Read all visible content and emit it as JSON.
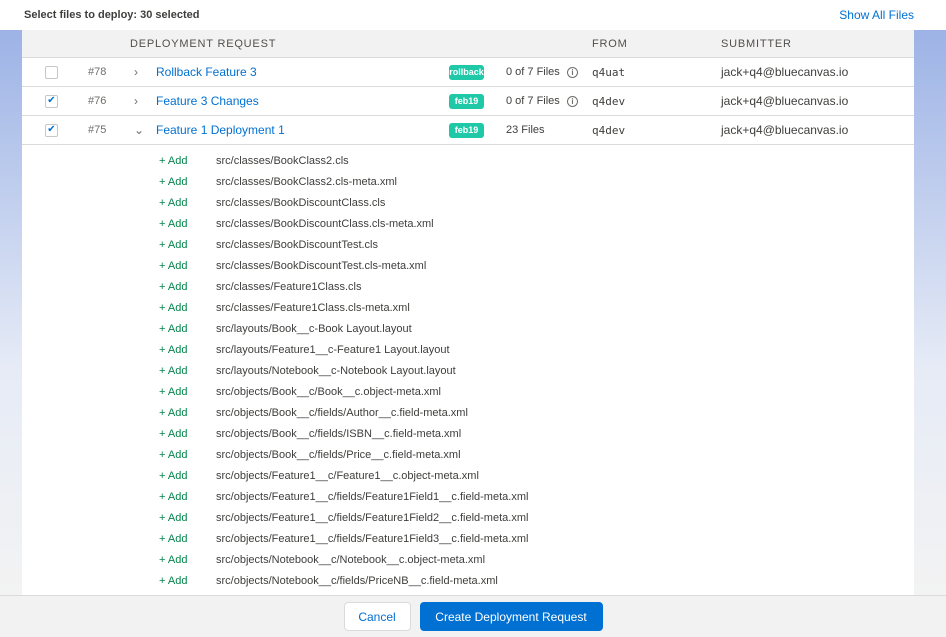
{
  "header": {
    "select_label": "Select files to deploy: 30 selected",
    "show_all": "Show All Files"
  },
  "table": {
    "columns": {
      "request": "DEPLOYMENT REQUEST",
      "from": "FROM",
      "submitter": "SUBMITTER"
    },
    "rows": [
      {
        "checked": false,
        "number": "#78",
        "title": "Rollback Feature 3",
        "badge": "rollback",
        "files": "0 of 7 Files",
        "info": true,
        "from": "q4uat",
        "submitter": "jack+q4@bluecanvas.io",
        "expanded": false
      },
      {
        "checked": true,
        "number": "#76",
        "title": "Feature 3 Changes",
        "badge": "feb19",
        "files": "0 of 7 Files",
        "info": true,
        "from": "q4dev",
        "submitter": "jack+q4@bluecanvas.io",
        "expanded": false
      },
      {
        "checked": true,
        "number": "#75",
        "title": "Feature 1 Deployment 1",
        "badge": "feb19",
        "files": "23 Files",
        "info": false,
        "from": "q4dev",
        "submitter": "jack+q4@bluecanvas.io",
        "expanded": true
      }
    ]
  },
  "file_action_label": "+ Add",
  "files": [
    "src/classes/BookClass2.cls",
    "src/classes/BookClass2.cls-meta.xml",
    "src/classes/BookDiscountClass.cls",
    "src/classes/BookDiscountClass.cls-meta.xml",
    "src/classes/BookDiscountTest.cls",
    "src/classes/BookDiscountTest.cls-meta.xml",
    "src/classes/Feature1Class.cls",
    "src/classes/Feature1Class.cls-meta.xml",
    "src/layouts/Book__c-Book Layout.layout",
    "src/layouts/Feature1__c-Feature1 Layout.layout",
    "src/layouts/Notebook__c-Notebook Layout.layout",
    "src/objects/Book__c/Book__c.object-meta.xml",
    "src/objects/Book__c/fields/Author__c.field-meta.xml",
    "src/objects/Book__c/fields/ISBN__c.field-meta.xml",
    "src/objects/Book__c/fields/Price__c.field-meta.xml",
    "src/objects/Feature1__c/Feature1__c.object-meta.xml",
    "src/objects/Feature1__c/fields/Feature1Field1__c.field-meta.xml",
    "src/objects/Feature1__c/fields/Feature1Field2__c.field-meta.xml",
    "src/objects/Feature1__c/fields/Feature1Field3__c.field-meta.xml",
    "src/objects/Notebook__c/Notebook__c.object-meta.xml",
    "src/objects/Notebook__c/fields/PriceNB__c.field-meta.xml"
  ],
  "footer": {
    "cancel": "Cancel",
    "create": "Create Deployment Request"
  },
  "colors": {
    "accent": "#0070d2",
    "badge": "#1fc9a7",
    "add": "#04844b"
  },
  "icons": {
    "expand": "chevron-right-icon",
    "collapse": "chevron-down-icon",
    "info": "info-icon",
    "check": "checkmark-icon"
  }
}
